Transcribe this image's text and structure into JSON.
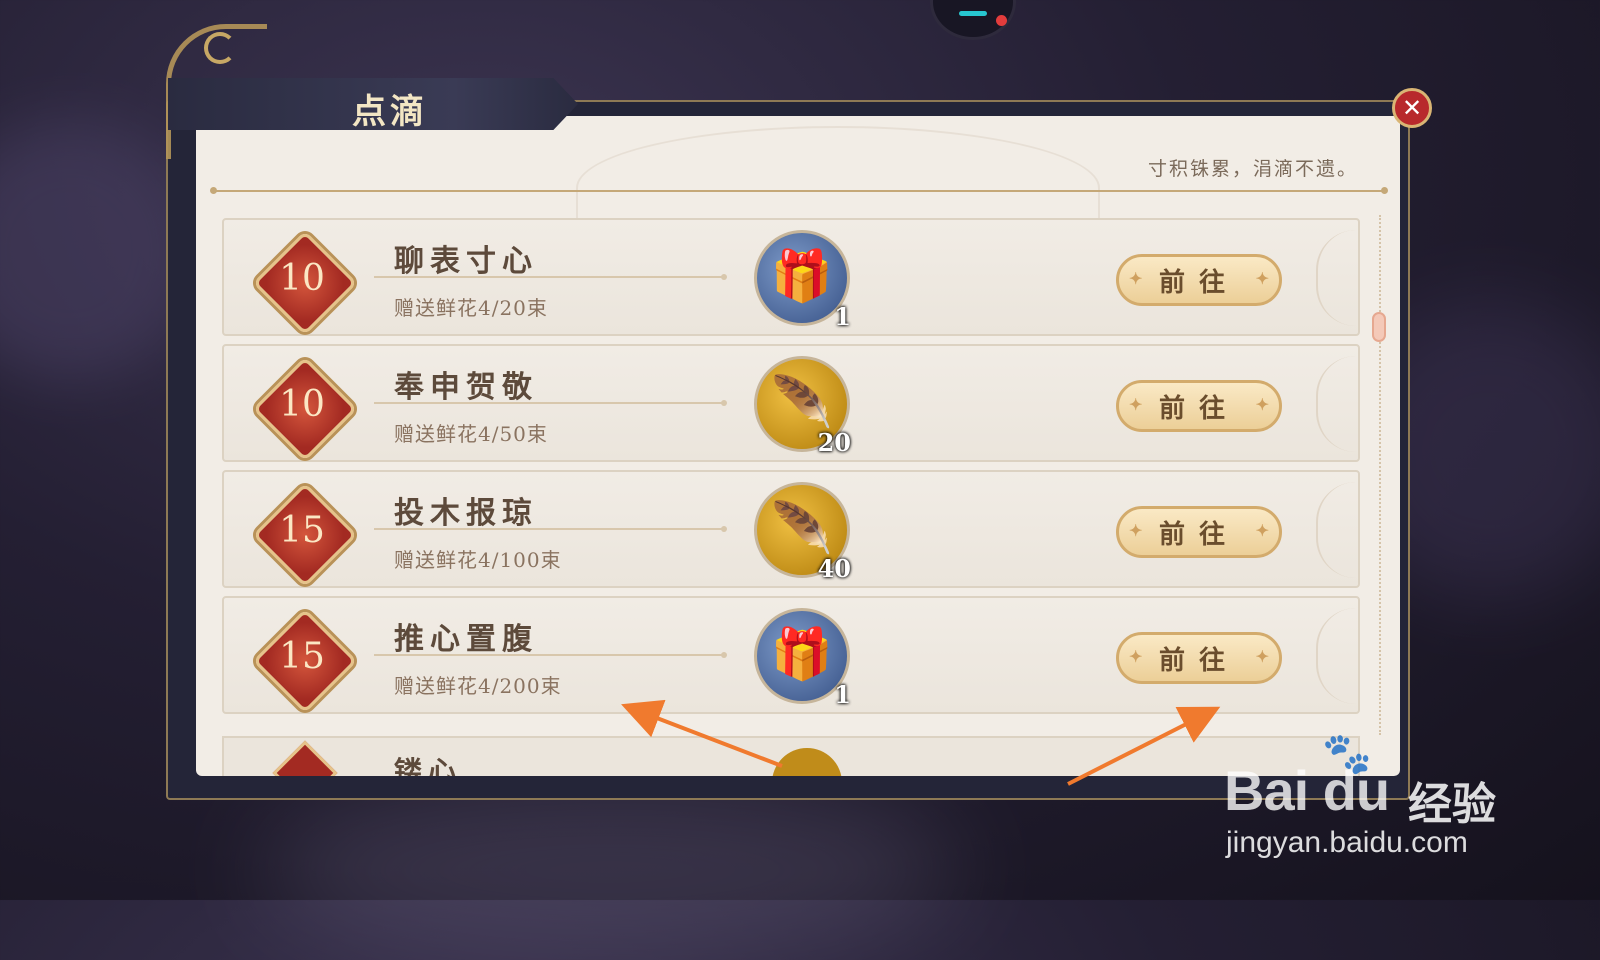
{
  "panel": {
    "title": "点滴",
    "quote": "寸积铢累，涓滴不遗。",
    "close_icon": "close-icon"
  },
  "rows": [
    {
      "badge": "10",
      "name": "聊表寸心",
      "progress": "赠送鲜花4/20束",
      "reward_icon": "flower-bag-icon",
      "reward_qty": "1",
      "button": "前往"
    },
    {
      "badge": "10",
      "name": "奉申贺敬",
      "progress": "赠送鲜花4/50束",
      "reward_icon": "gold-feather-icon",
      "reward_qty": "20",
      "button": "前往"
    },
    {
      "badge": "15",
      "name": "投木报琼",
      "progress": "赠送鲜花4/100束",
      "reward_icon": "gold-feather-icon",
      "reward_qty": "40",
      "button": "前往"
    },
    {
      "badge": "15",
      "name": "推心置腹",
      "progress": "赠送鲜花4/200束",
      "reward_icon": "flower-bag-icon",
      "reward_qty": "1",
      "button": "前往"
    }
  ],
  "partial_row": {
    "name": "镂心..."
  },
  "watermark": {
    "logo": "Bai du",
    "suffix": "经验",
    "url": "jingyan.baidu.com"
  },
  "colors": {
    "accent_red": "#a32a22",
    "button_gold": "#eccf98",
    "arrow": "#f07a2e"
  }
}
